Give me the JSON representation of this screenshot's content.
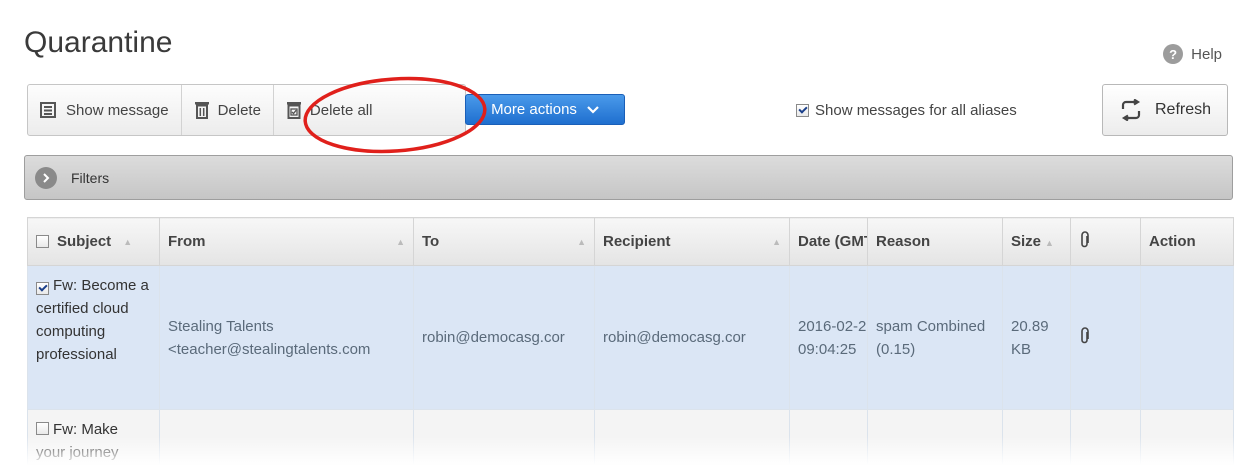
{
  "page": {
    "title": "Quarantine",
    "help_label": "Help"
  },
  "toolbar": {
    "show_message": "Show message",
    "delete": "Delete",
    "delete_all": "Delete all",
    "more_actions": "More actions",
    "show_aliases": "Show messages for all aliases",
    "show_aliases_checked": true,
    "refresh": "Refresh"
  },
  "filters": {
    "label": "Filters"
  },
  "table": {
    "columns": {
      "subject": "Subject",
      "from": "From",
      "to": "To",
      "recipient": "Recipient",
      "date": "Date (GMT",
      "reason": "Reason",
      "size": "Size",
      "action": "Action"
    },
    "rows": [
      {
        "checked": true,
        "subject": "Fw: Become a certified cloud computing professional",
        "from": "Stealing Talents <teacher@stealingtalents.com",
        "to": "robin@democasg.cor",
        "recipient": "robin@democasg.cor",
        "date": "2016-02-2",
        "time": "09:04:25",
        "reason": "spam Combined (0.15)",
        "size": "20.89 KB",
        "has_attachment": true
      },
      {
        "checked": false,
        "subject": "Fw: Make your journey"
      }
    ]
  },
  "annotation": {
    "color": "#e0201b",
    "target": "Delete all"
  }
}
